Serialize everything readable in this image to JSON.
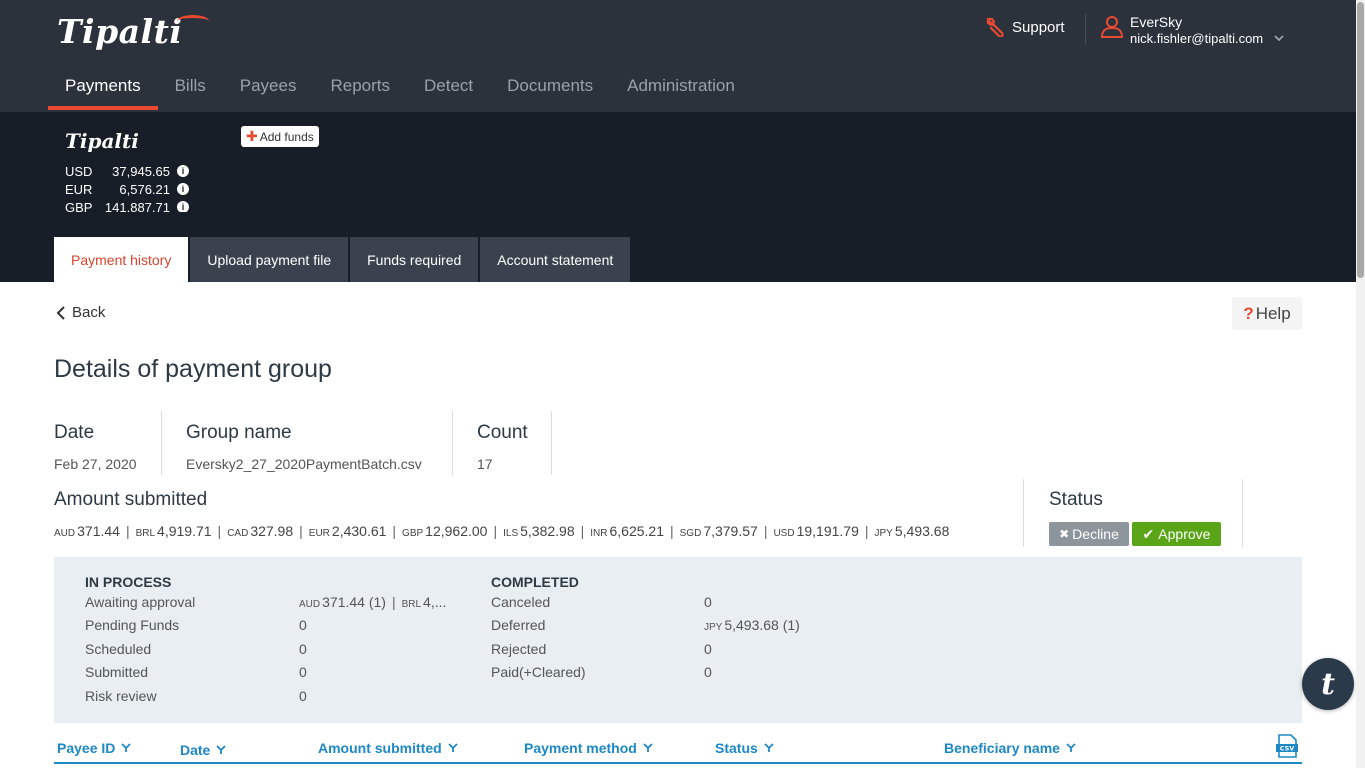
{
  "brand": {
    "logo_text": "Tipalti",
    "accent": "#e84a31"
  },
  "nav": {
    "items": [
      "Payments",
      "Bills",
      "Payees",
      "Reports",
      "Detect",
      "Documents",
      "Administration"
    ],
    "active": "Payments"
  },
  "header": {
    "support_label": "Support",
    "user_name": "EverSky",
    "user_email": "nick.fishler@tipalti.com"
  },
  "funds": {
    "logo_text": "Tipalti",
    "add_funds_label": "Add funds",
    "balances": [
      {
        "currency": "USD",
        "amount": "37,945.65"
      },
      {
        "currency": "EUR",
        "amount": "6,576.21"
      },
      {
        "currency": "GBP",
        "amount": "141,887.71"
      }
    ]
  },
  "tabs": [
    "Payment history",
    "Upload payment file",
    "Funds required",
    "Account statement"
  ],
  "page": {
    "back_label": "Back",
    "help_label": "Help",
    "title": "Details of payment group",
    "date_label": "Date",
    "date_value": "Feb 27, 2020",
    "group_label": "Group name",
    "group_value": "Eversky2_27_2020PaymentBatch.csv",
    "count_label": "Count",
    "count_value": "17",
    "amount_label": "Amount submitted",
    "amounts": [
      {
        "c": "AUD",
        "v": "371.44"
      },
      {
        "c": "BRL",
        "v": "4,919.71"
      },
      {
        "c": "CAD",
        "v": "327.98"
      },
      {
        "c": "EUR",
        "v": "2,430.61"
      },
      {
        "c": "GBP",
        "v": "12,962.00"
      },
      {
        "c": "ILS",
        "v": "5,382.98"
      },
      {
        "c": "INR",
        "v": "6,625.21"
      },
      {
        "c": "SGD",
        "v": "7,379.57"
      },
      {
        "c": "USD",
        "v": "19,191.79"
      },
      {
        "c": "JPY",
        "v": "5,493.68"
      }
    ],
    "status_label": "Status",
    "decline_label": "Decline",
    "approve_label": "Approve"
  },
  "summary": {
    "in_process": {
      "title": "IN PROCESS",
      "rows": [
        {
          "label": "Awaiting approval",
          "cur1": "AUD",
          "val1": "371.44 (1)",
          "cur2": "BRL",
          "val2": "4,..."
        },
        {
          "label": "Pending Funds",
          "value": "0"
        },
        {
          "label": "Scheduled",
          "value": "0"
        },
        {
          "label": "Submitted",
          "value": "0"
        },
        {
          "label": "Risk review",
          "value": "0"
        }
      ]
    },
    "completed": {
      "title": "COMPLETED",
      "rows": [
        {
          "label": "Canceled",
          "value": "0"
        },
        {
          "label": "Deferred",
          "cur": "JPY",
          "value": "5,493.68 (1)"
        },
        {
          "label": "Rejected",
          "value": "0"
        },
        {
          "label": "Paid(+Cleared)",
          "value": "0"
        }
      ]
    }
  },
  "table": {
    "columns": [
      "Payee ID",
      "Date",
      "Amount submitted",
      "Payment method",
      "Status",
      "Beneficiary name"
    ],
    "csv_label": "CSV"
  },
  "chat": {
    "glyph": "t"
  }
}
